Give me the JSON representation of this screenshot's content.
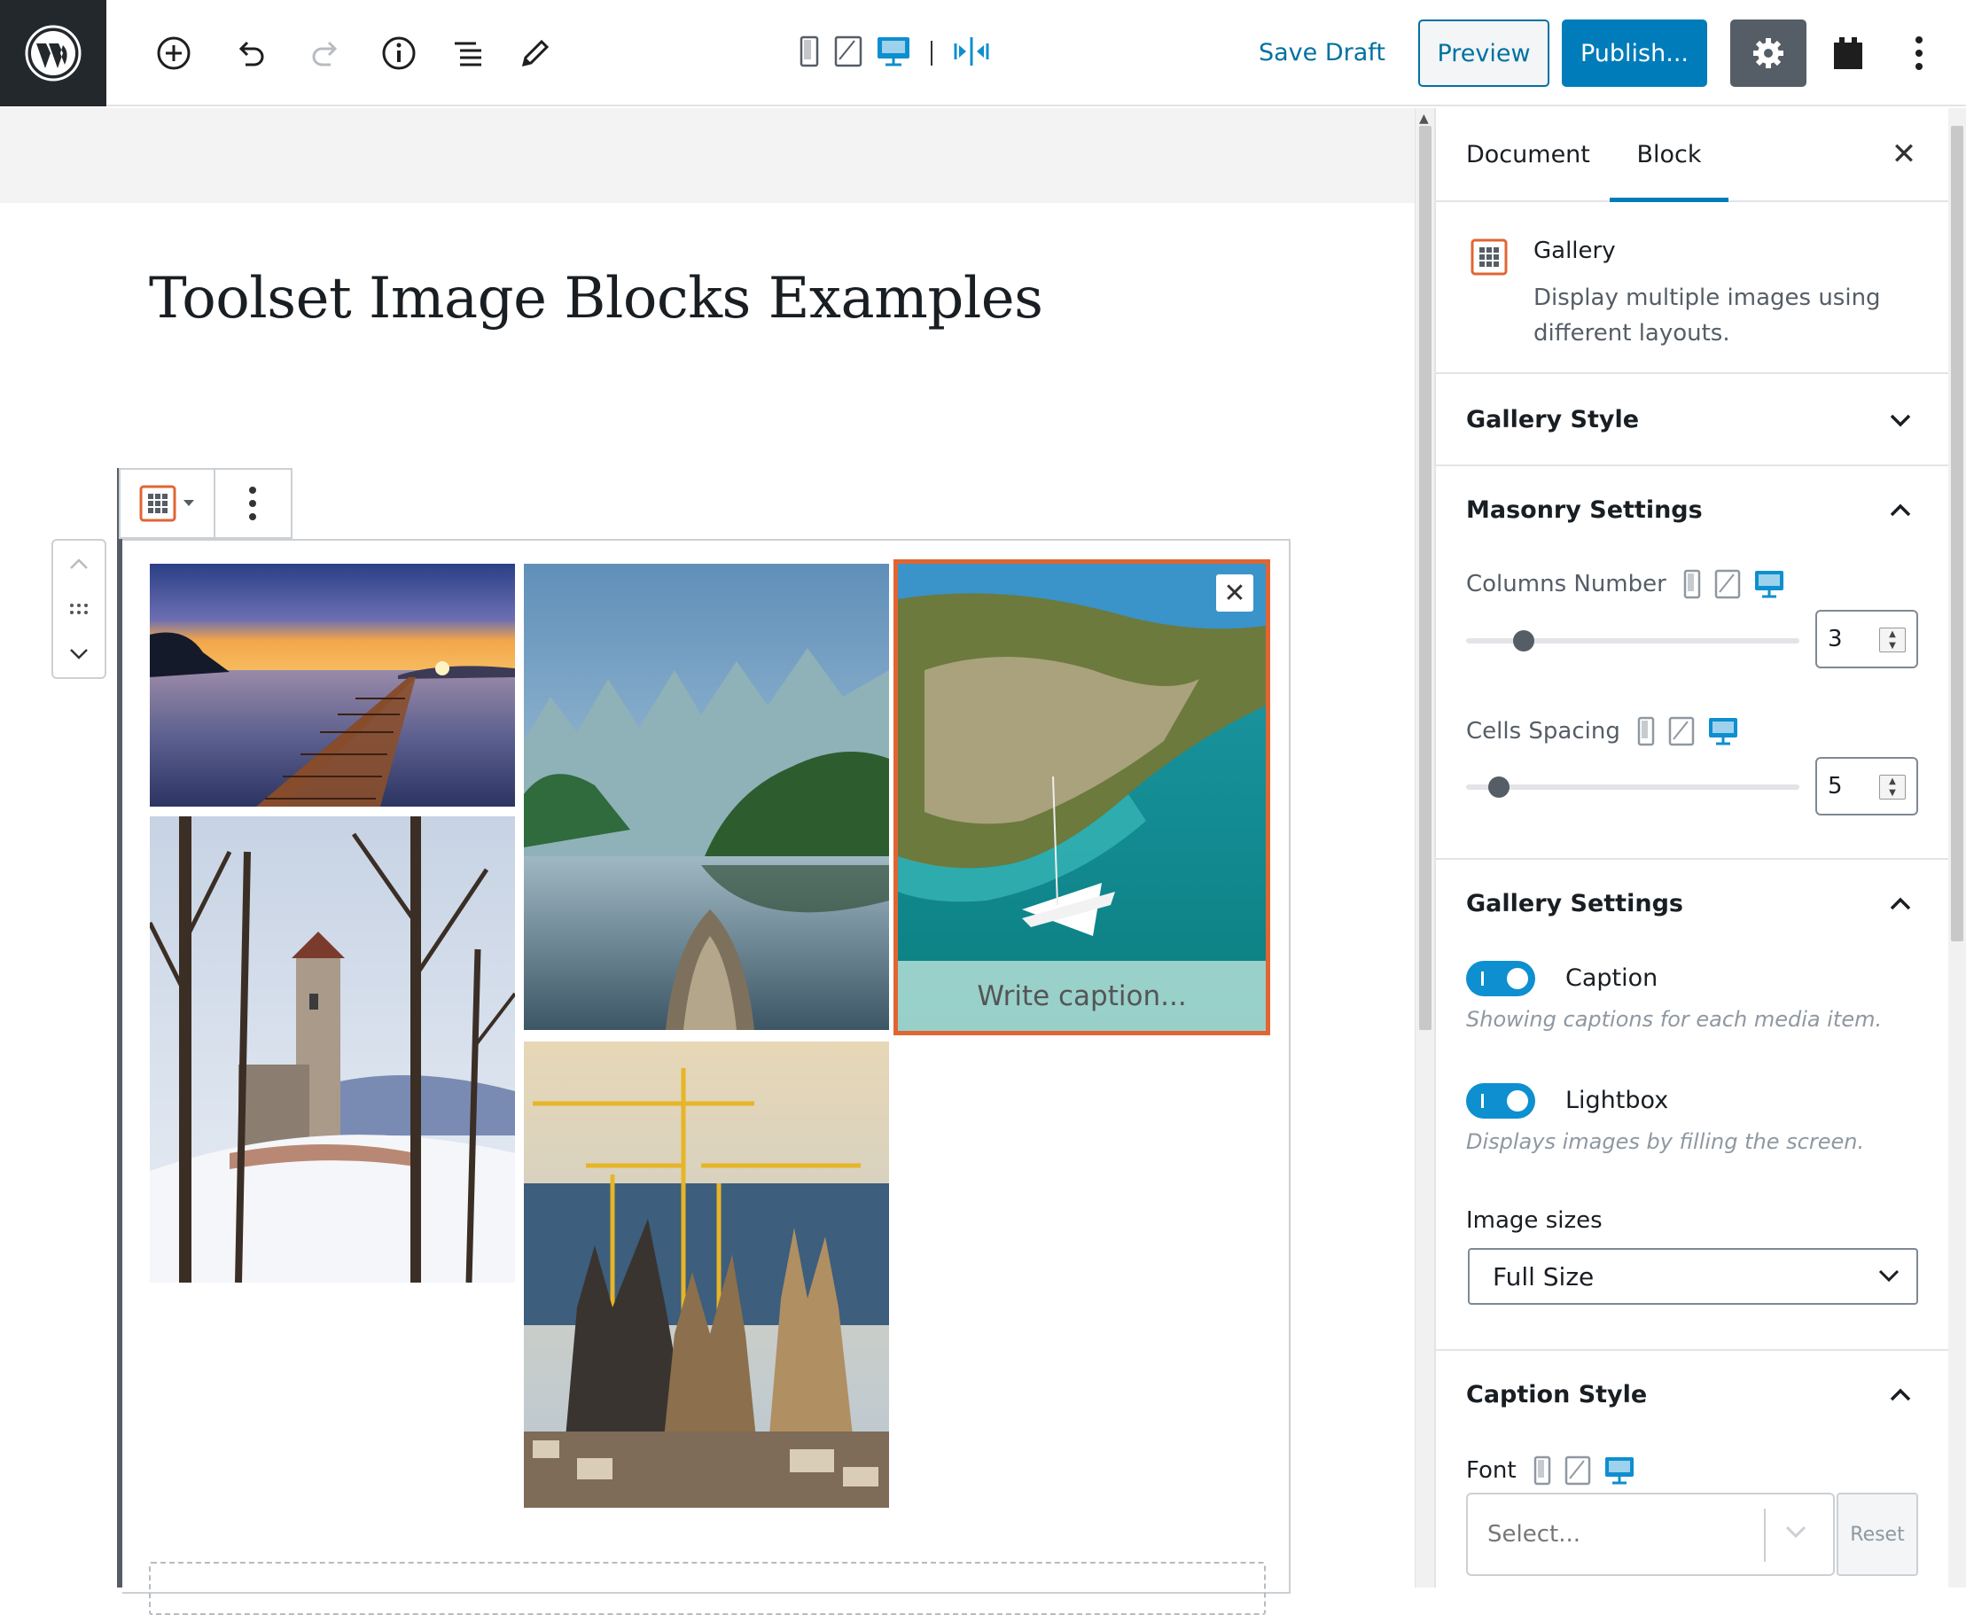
{
  "toolbar": {
    "save_draft": "Save Draft",
    "preview": "Preview",
    "publish": "Publish...",
    "icons": [
      "wordpress-logo",
      "add-block",
      "undo",
      "redo",
      "info",
      "block-navigation",
      "tools-edit",
      "view-mobile",
      "view-tablet",
      "view-desktop",
      "responsive-toggle",
      "settings-gear",
      "plugin",
      "more-menu"
    ]
  },
  "post": {
    "title": "Toolset Image Blocks Examples"
  },
  "gallery": {
    "images": [
      "pier-sunset",
      "karst-river-boat",
      "sailboat-bay",
      "winter-tower",
      "sagrada-familia-cranes"
    ],
    "selected_caption_placeholder": "Write caption...",
    "close_symbol": "✕"
  },
  "sidebar": {
    "tabs": {
      "document": "Document",
      "block": "Block"
    },
    "close_symbol": "✕",
    "block_card": {
      "title": "Gallery",
      "description": "Display multiple images using different layouts."
    },
    "panels": {
      "gallery_style": "Gallery Style",
      "masonry_settings": "Masonry Settings",
      "gallery_settings": "Gallery Settings",
      "caption_style": "Caption Style"
    },
    "masonry": {
      "columns_label": "Columns Number",
      "columns_value": "3",
      "columns_slider_fraction": 0.15,
      "spacing_label": "Cells Spacing",
      "spacing_value": "5",
      "spacing_slider_fraction": 0.07
    },
    "gallery_settings": {
      "caption_label": "Caption",
      "caption_help": "Showing captions for each media item.",
      "lightbox_label": "Lightbox",
      "lightbox_help": "Displays images by filling the screen.",
      "image_sizes_label": "Image sizes",
      "image_sizes_value": "Full Size"
    },
    "caption_style": {
      "font_label": "Font",
      "font_placeholder": "Select...",
      "reset": "Reset"
    }
  },
  "colors": {
    "accent": "#007cba",
    "selected_border": "#e06533",
    "dark_bar": "#23282d"
  }
}
